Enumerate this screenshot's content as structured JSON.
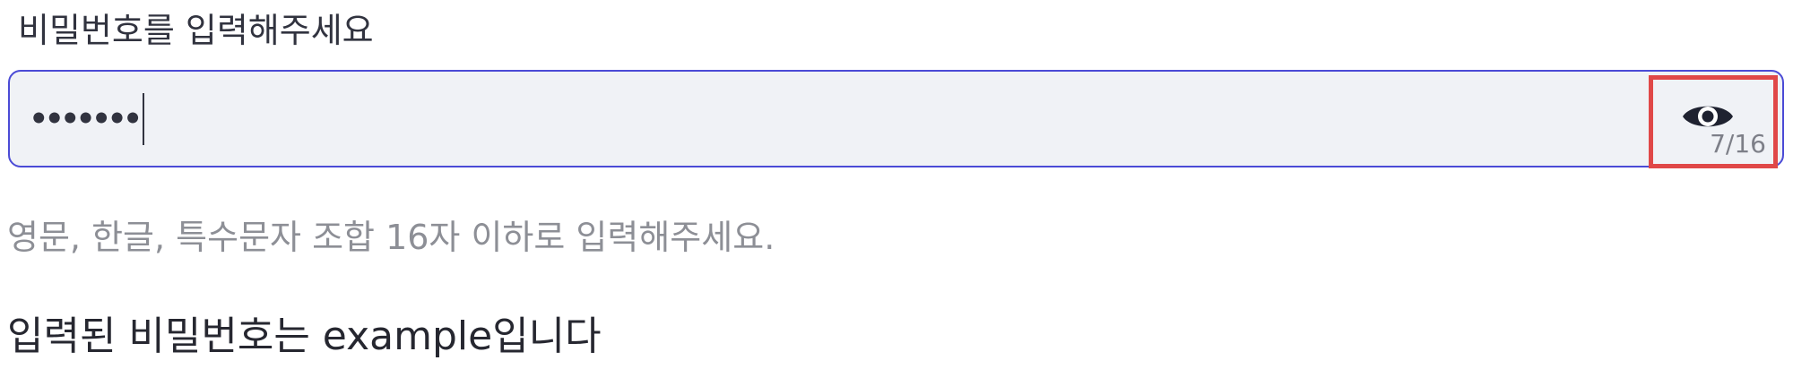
{
  "field": {
    "label": "비밀번호를 입력해주세요",
    "masked_value": "•••••••",
    "counter": "7/16",
    "toggle_icon": "eye-icon",
    "help_text": "영문, 한글, 특수문자 조합 16자 이하로 입력해주세요."
  },
  "result": {
    "text": "입력된 비밀번호는 example입니다"
  },
  "colors": {
    "focus_border": "#4b4bd6",
    "input_background": "#f0f2f6",
    "highlight_box": "#e04848"
  }
}
